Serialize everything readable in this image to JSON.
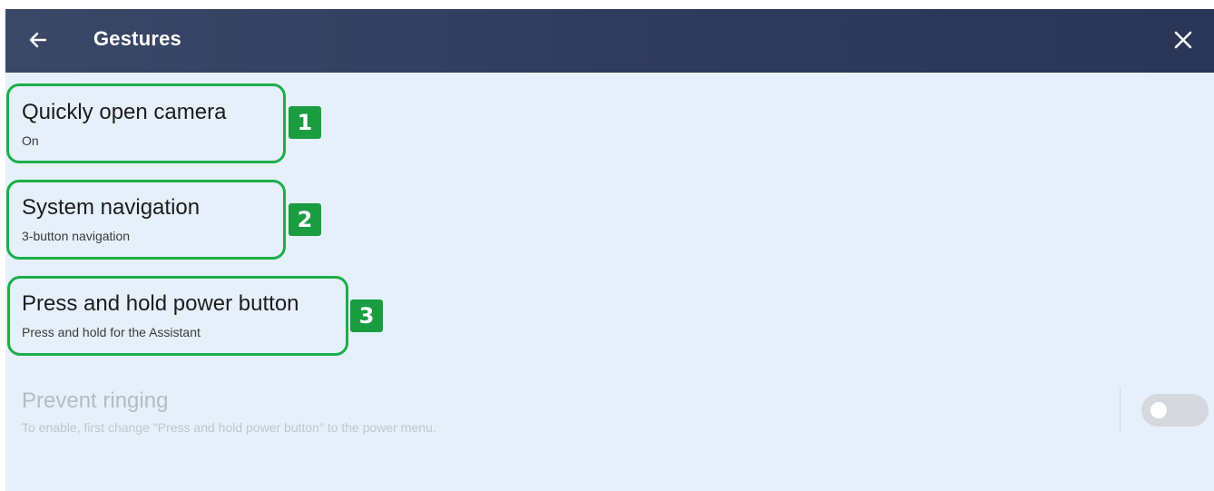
{
  "header": {
    "title": "Gestures",
    "back_icon": "arrow-left-icon",
    "close_icon": "close-icon",
    "background_color": "#2f3b5d"
  },
  "settings": [
    {
      "title": "Quickly open camera",
      "subtitle": "On",
      "badge": "1",
      "enabled": true
    },
    {
      "title": "System navigation",
      "subtitle": "3-button navigation",
      "badge": "2",
      "enabled": true
    },
    {
      "title": "Press and hold power button",
      "subtitle": "Press and hold for the Assistant",
      "badge": "3",
      "enabled": true
    },
    {
      "title": "Prevent ringing",
      "subtitle": "To enable, first change \"Press and hold power button\" to the power menu.",
      "enabled": false,
      "toggle_on": false
    }
  ],
  "colors": {
    "highlight": "#1cae4a",
    "badge": "#1a9c40",
    "content_background": "#e5f0fa"
  }
}
